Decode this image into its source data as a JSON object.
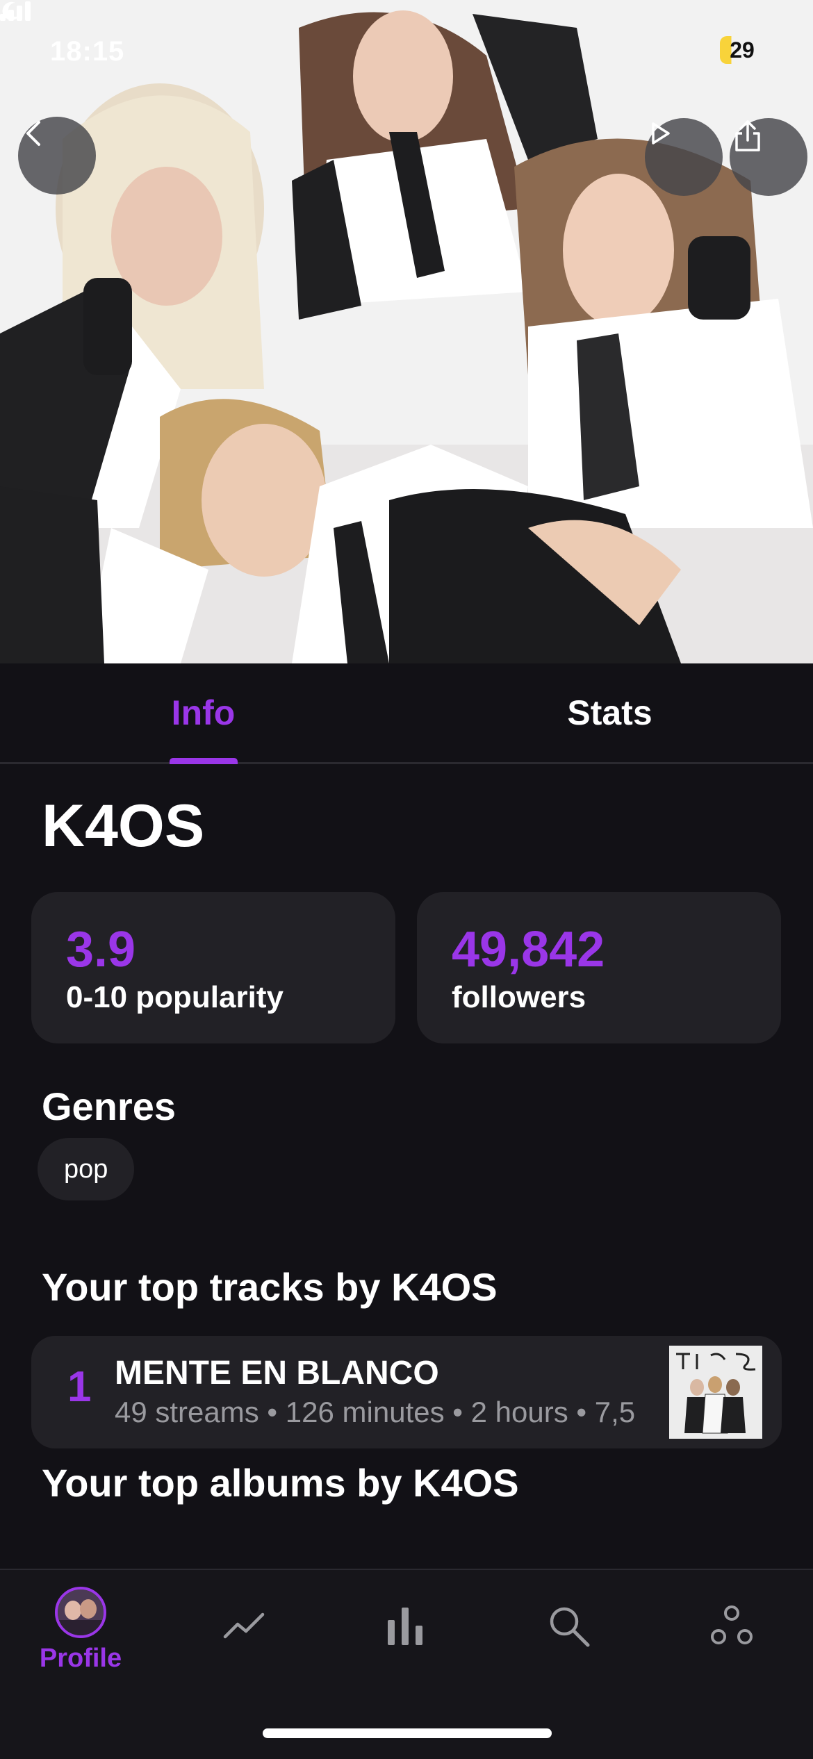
{
  "status_bar": {
    "time": "18:15",
    "battery": "29",
    "colors": {
      "battery_fill": "#f8d33a"
    }
  },
  "hero": {
    "image": "artist-group-photo",
    "buttons": {
      "back_icon": "chevron-left-icon",
      "play_icon": "play-icon",
      "share_icon": "share-icon"
    }
  },
  "tabs": [
    {
      "label": "Info",
      "active": true
    },
    {
      "label": "Stats",
      "active": false
    }
  ],
  "artist": {
    "name": "K4OS"
  },
  "stats": {
    "popularity": {
      "value": "3.9",
      "label": "0-10 popularity"
    },
    "followers": {
      "value": "49,842",
      "label": "followers"
    }
  },
  "genres": {
    "title": "Genres",
    "items": [
      "pop"
    ]
  },
  "top_tracks": {
    "title": "Your top tracks by K4OS",
    "items": [
      {
        "rank": "1",
        "title": "MENTE EN BLANCO",
        "meta": "49 streams • 126 minutes • 2 hours • 7,5",
        "art": "album-art-thumbnail"
      }
    ]
  },
  "top_albums": {
    "title": "Your top albums by K4OS"
  },
  "bottom_nav": {
    "items": [
      {
        "label": "Profile",
        "icon": "profile-avatar",
        "active": true
      },
      {
        "label": "",
        "icon": "trend-line-icon"
      },
      {
        "label": "",
        "icon": "bar-chart-icon"
      },
      {
        "label": "",
        "icon": "search-icon"
      },
      {
        "label": "",
        "icon": "friends-icon"
      }
    ]
  },
  "colors": {
    "accent": "#9a36e8",
    "background": "#121116",
    "card": "#222126",
    "muted_text": "#9a9a9f"
  }
}
